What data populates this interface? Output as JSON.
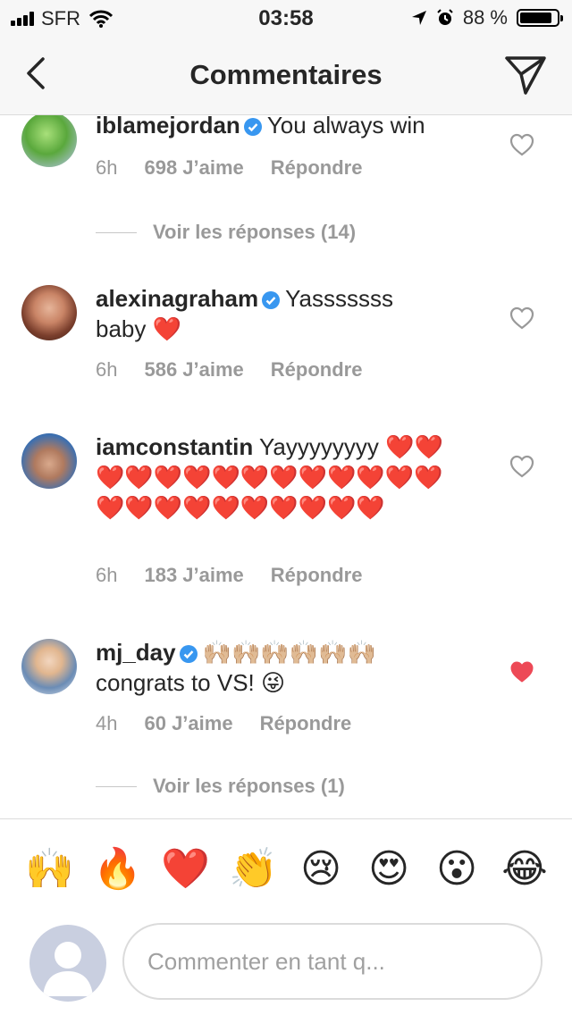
{
  "status": {
    "carrier": "SFR",
    "time": "03:58",
    "battery": "88 %",
    "battery_level": 0.88
  },
  "nav": {
    "title": "Commentaires"
  },
  "comments": [
    {
      "user": "iblamejordan",
      "verified": true,
      "text": "You always win",
      "time": "6h",
      "likes": "698 J’aime",
      "reply": "Répondre",
      "liked": false,
      "replies": "Voir les réponses (14)"
    },
    {
      "user": "alexinagraham",
      "verified": true,
      "text_line1": "Yasssssss",
      "text_line2": "baby ❤️",
      "time": "6h",
      "likes": "586 J’aime",
      "reply": "Répondre",
      "liked": false
    },
    {
      "user": "iamconstantin",
      "verified": false,
      "text": "Yayyyyyyyy ❤️❤️❤️❤️❤️❤️❤️❤️❤️❤️❤️❤️❤️❤️❤️❤️❤️❤️❤️❤️❤️❤️❤️❤️",
      "time": "6h",
      "likes": "183 J’aime",
      "reply": "Répondre",
      "liked": false
    },
    {
      "user": "mj_day",
      "verified": true,
      "text_line1": "🙌🏼🙌🏼🙌🏼🙌🏼🙌🏼🙌🏼",
      "text_line2": "congrats to VS! 😜",
      "time": "4h",
      "likes": "60 J’aime",
      "reply": "Répondre",
      "liked": true,
      "replies": "Voir les réponses (1)"
    }
  ],
  "quick_emojis": [
    "🙌",
    "🔥",
    "❤️",
    "👏",
    "😢",
    "😍",
    "😮",
    "😂"
  ],
  "composer": {
    "placeholder": "Commenter en tant q..."
  },
  "colors": {
    "liked_heart": "#ed4956",
    "verified": "#3897f0",
    "muted": "#999999"
  }
}
